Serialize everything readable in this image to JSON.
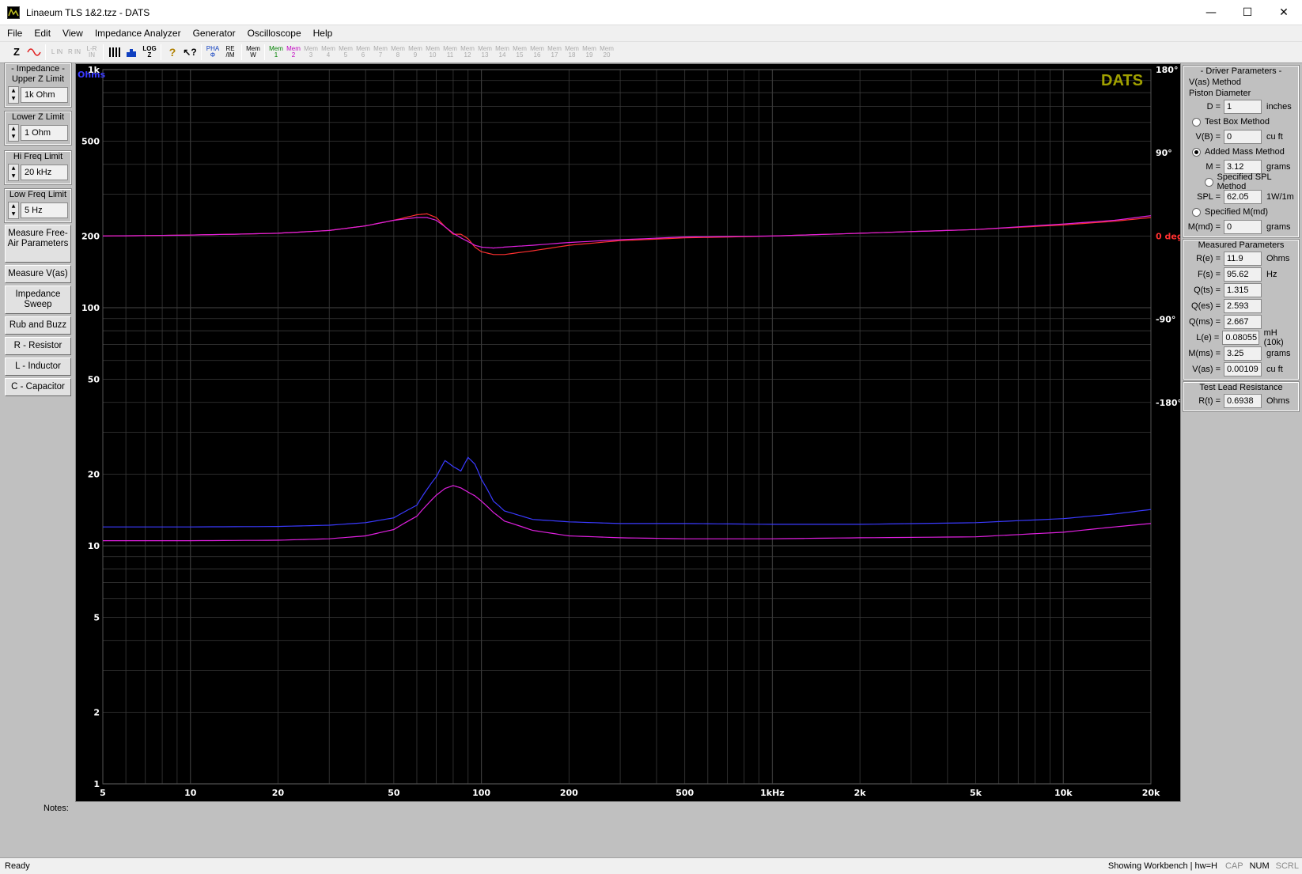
{
  "window": {
    "title": "Linaeum TLS 1&2.tzz - DATS",
    "controls": [
      "—",
      "☐",
      "✕"
    ]
  },
  "menu": [
    {
      "label": "File"
    },
    {
      "label": "Edit"
    },
    {
      "label": "View"
    },
    {
      "label": "Impedance Analyzer"
    },
    {
      "label": "Generator"
    },
    {
      "label": "Oscilloscope"
    },
    {
      "label": "Help"
    }
  ],
  "toolbar": {
    "z": "Z",
    "l_in": "L IN",
    "r_in": "R IN",
    "lr_in": "L-R IN",
    "log": "LOG Z",
    "pha": "PHA Φ",
    "reim": "RE /IM",
    "mem_w": "Mem W",
    "mem1": "Mem 1",
    "mem2": "Mem 2",
    "mem_gray": [
      "Mem 3",
      "Mem 4",
      "Mem 5",
      "Mem 6",
      "Mem 7",
      "Mem 8",
      "Mem 9",
      "Mem 10",
      "Mem 11",
      "Mem 12",
      "Mem 13",
      "Mem 14",
      "Mem 15",
      "Mem 16",
      "Mem 17",
      "Mem 18",
      "Mem 19",
      "Mem 20"
    ]
  },
  "left": {
    "impedance_title": "- Impedance -",
    "upper_label": "Upper Z Limit",
    "upper_value": "1k Ohm",
    "lower_label": "Lower Z Limit",
    "lower_value": "1 Ohm",
    "hifreq_label": "Hi Freq Limit",
    "hifreq_value": "20 kHz",
    "lowfreq_label": "Low Freq Limit",
    "lowfreq_value": "5 Hz",
    "btn_freeair": "Measure Free-Air Parameters",
    "btn_vas": "Measure V(as)",
    "btn_sweep": "Impedance Sweep",
    "btn_rub": "Rub and Buzz",
    "btn_r": "R - Resistor",
    "btn_l": "L - Inductor",
    "btn_c": "C - Capacitor"
  },
  "plot": {
    "brand": "DATS",
    "yunit": "Ohms",
    "phase_unit": "0 deg",
    "colors": {
      "bg": "#000000",
      "grid": "#3a3a3a",
      "blue": "#3a3aff",
      "magenta": "#e020e0",
      "red": "#ff3030",
      "brand": "#a0a000",
      "labels": "#ffffff"
    }
  },
  "chart_data": {
    "type": "line",
    "title": "",
    "xlabel": "",
    "ylabel": "Ohms",
    "x_scale": "log",
    "y_scale": "log",
    "xlim": [
      5,
      20000
    ],
    "ylim": [
      1,
      1000
    ],
    "y2lim": [
      -180,
      180
    ],
    "y2label": "deg",
    "x_ticks": [
      {
        "v": 5,
        "t": "5"
      },
      {
        "v": 10,
        "t": "10"
      },
      {
        "v": 20,
        "t": "20"
      },
      {
        "v": 50,
        "t": "50"
      },
      {
        "v": 100,
        "t": "100"
      },
      {
        "v": 200,
        "t": "200"
      },
      {
        "v": 500,
        "t": "500"
      },
      {
        "v": 1000,
        "t": "1kHz"
      },
      {
        "v": 2000,
        "t": "2k"
      },
      {
        "v": 5000,
        "t": "5k"
      },
      {
        "v": 10000,
        "t": "10k"
      },
      {
        "v": 20000,
        "t": "20k"
      }
    ],
    "y_ticks": [
      {
        "v": 1,
        "t": "1"
      },
      {
        "v": 2,
        "t": "2"
      },
      {
        "v": 5,
        "t": "5"
      },
      {
        "v": 10,
        "t": "10"
      },
      {
        "v": 20,
        "t": "20"
      },
      {
        "v": 50,
        "t": "50"
      },
      {
        "v": 100,
        "t": "100"
      },
      {
        "v": 200,
        "t": "200"
      },
      {
        "v": 500,
        "t": "500"
      },
      {
        "v": 1000,
        "t": "1k"
      }
    ],
    "y2_ticks": [
      {
        "v": 180,
        "t": "180°"
      },
      {
        "v": 90,
        "t": "90°"
      },
      {
        "v": -90,
        "t": "-90°"
      },
      {
        "v": -180,
        "t": "-180°"
      }
    ],
    "grid": true,
    "series": [
      {
        "axis": "y",
        "color": "#3a3aff",
        "x": [
          5,
          10,
          20,
          30,
          40,
          50,
          60,
          70,
          75,
          80,
          85,
          90,
          95,
          100,
          110,
          120,
          150,
          200,
          300,
          500,
          1000,
          2000,
          5000,
          10000,
          15000,
          20000
        ],
        "y": [
          12.0,
          12.0,
          12.05,
          12.2,
          12.5,
          13.1,
          14.8,
          19.5,
          22.8,
          21.5,
          20.6,
          23.5,
          22.0,
          19.0,
          15.4,
          14.0,
          12.9,
          12.6,
          12.4,
          12.4,
          12.3,
          12.3,
          12.5,
          13.0,
          13.6,
          14.2
        ]
      },
      {
        "axis": "y",
        "color": "#e020e0",
        "x": [
          5,
          10,
          20,
          30,
          40,
          50,
          60,
          70,
          75,
          80,
          85,
          90,
          95,
          100,
          110,
          120,
          150,
          200,
          300,
          500,
          1000,
          2000,
          5000,
          10000,
          15000,
          20000
        ],
        "y": [
          10.5,
          10.5,
          10.55,
          10.7,
          11.0,
          11.7,
          13.3,
          16.3,
          17.4,
          17.9,
          17.5,
          16.8,
          16.2,
          15.4,
          13.8,
          12.7,
          11.6,
          11.0,
          10.8,
          10.7,
          10.7,
          10.8,
          10.9,
          11.4,
          12.0,
          12.4
        ]
      },
      {
        "axis": "y2",
        "color": "#ff3030",
        "x": [
          5,
          10,
          20,
          30,
          40,
          50,
          60,
          65,
          70,
          75,
          80,
          85,
          90,
          95,
          100,
          110,
          120,
          150,
          200,
          300,
          500,
          1000,
          2000,
          5000,
          10000,
          15000,
          20000
        ],
        "y": [
          0,
          1,
          3,
          6,
          11,
          17,
          23,
          24,
          20,
          10,
          2,
          2,
          -3,
          -12,
          -17,
          -20,
          -20,
          -16,
          -10,
          -5,
          -2,
          0,
          3,
          7,
          12,
          16,
          20
        ]
      },
      {
        "axis": "y2",
        "color": "#e020e0",
        "x": [
          5,
          10,
          20,
          30,
          40,
          50,
          60,
          65,
          70,
          75,
          80,
          85,
          90,
          95,
          100,
          110,
          120,
          150,
          200,
          300,
          500,
          1000,
          2000,
          5000,
          10000,
          15000,
          20000
        ],
        "y": [
          0,
          1,
          3,
          6,
          11,
          17,
          20,
          20,
          17,
          10,
          3,
          -2,
          -6,
          -10,
          -12,
          -13,
          -12,
          -10,
          -7,
          -4,
          -1,
          0,
          3,
          7,
          13,
          17,
          22
        ]
      }
    ]
  },
  "right": {
    "driver_title": "- Driver Parameters -",
    "vas_method": "V(as) Method",
    "piston": "Piston Diameter",
    "d_label": "D =",
    "d_value": "1",
    "d_unit": "inches",
    "testbox": "Test Box Method",
    "vb_label": "V(B) =",
    "vb_value": "0",
    "vb_unit": "cu ft",
    "addedmass": "Added Mass Method",
    "m_label": "M =",
    "m_value": "3.12",
    "m_unit": "grams",
    "specspl": "Specified SPL Method",
    "spl_label": "SPL =",
    "spl_value": "62.05",
    "spl_unit": "1W/1m",
    "specmmd": "Specified M(md)",
    "mmd_label": "M(md) =",
    "mmd_value": "0",
    "mmd_unit": "grams",
    "measured_title": "Measured Parameters",
    "measured": [
      {
        "label": "R(e) =",
        "value": "11.9",
        "unit": "Ohms"
      },
      {
        "label": "F(s) =",
        "value": "95.62",
        "unit": "Hz"
      },
      {
        "label": "Q(ts) =",
        "value": "1.315",
        "unit": ""
      },
      {
        "label": "Q(es) =",
        "value": "2.593",
        "unit": ""
      },
      {
        "label": "Q(ms) =",
        "value": "2.667",
        "unit": ""
      },
      {
        "label": "L(e) =",
        "value": "0.08055",
        "unit": "mH (10k)"
      },
      {
        "label": "M(ms) =",
        "value": "3.25",
        "unit": "grams"
      },
      {
        "label": "V(as) =",
        "value": "0.00109",
        "unit": "cu ft"
      }
    ],
    "lead_title": "Test Lead Resistance",
    "rt_label": "R(t) =",
    "rt_value": "0.6938",
    "rt_unit": "Ohms"
  },
  "notes_label": "Notes:",
  "status": {
    "left": "Ready",
    "right": "Showing Workbench | hw=H",
    "cap": "CAP",
    "num": "NUM",
    "scrl": "SCRL"
  }
}
